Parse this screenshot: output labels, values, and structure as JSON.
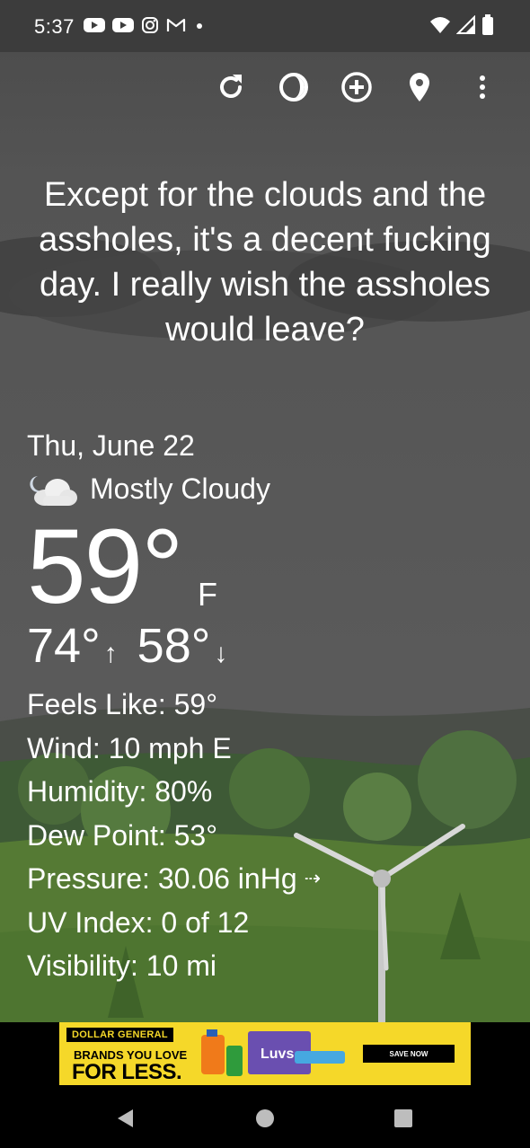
{
  "status_bar": {
    "time": "5:37",
    "notification_icons": [
      "youtube-icon",
      "youtube-icon",
      "instagram-icon",
      "gmail-icon",
      "dot-icon"
    ],
    "system_icons": [
      "wifi-icon",
      "signal-icon",
      "battery-icon"
    ]
  },
  "toolbar": {
    "icons": [
      "refresh-icon",
      "theme-icon",
      "add-location-icon",
      "location-pin-icon",
      "more-vert-icon"
    ]
  },
  "quote": "Except for the clouds and the assholes, it's a decent fucking day. I really wish the assholes would leave?",
  "weather": {
    "date": "Thu, June 22",
    "condition": "Mostly Cloudy",
    "condition_icon": "partly-cloudy-night-icon",
    "temperature": "59°",
    "unit": "F",
    "high": "74°",
    "high_arrow": "↑",
    "low": "58°",
    "low_arrow": "↓"
  },
  "details": {
    "feels_like": "Feels Like:  59°",
    "wind": "Wind:  10 mph E",
    "humidity": "Humidity:  80%",
    "dew_point": "Dew Point:  53°",
    "pressure": "Pressure:  30.06 inHg",
    "pressure_trend": "⇢",
    "uv_index": "UV Index:  0 of 12",
    "visibility": "Visibility:  10 mi"
  },
  "ad": {
    "brand": "DOLLAR GENERAL",
    "tagline1": "BRANDS YOU LOVE",
    "tagline2": "FOR LESS.",
    "cta": "SAVE NOW",
    "product_label": "Luvs",
    "colors": {
      "background": "#f5d829",
      "text": "#000000"
    }
  },
  "nav_bar": {
    "icons": [
      "back-icon",
      "home-icon",
      "recents-icon"
    ]
  }
}
